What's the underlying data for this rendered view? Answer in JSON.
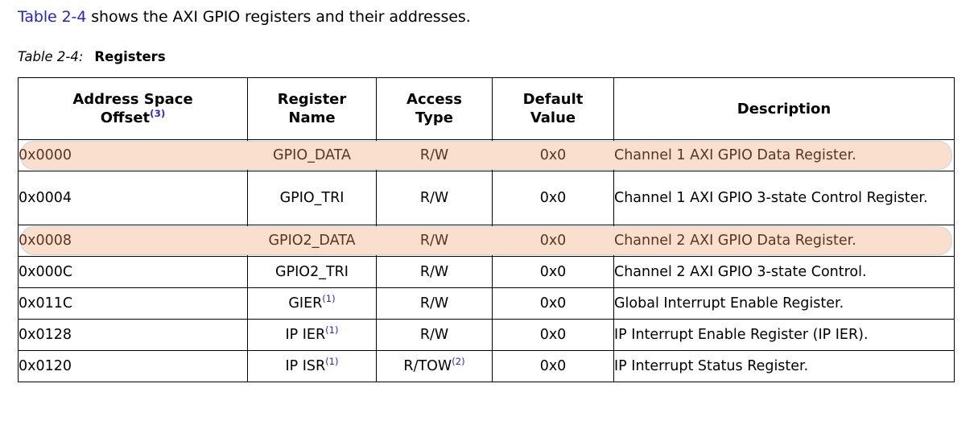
{
  "intro": {
    "link_text": "Table 2-4",
    "rest_text": " shows the AXI GPIO registers and their addresses."
  },
  "caption": {
    "number": "Table 2-4:",
    "title": "Registers"
  },
  "table": {
    "headers": [
      {
        "line1": "Address Space",
        "line2": "Offset",
        "sup": "(3)"
      },
      {
        "line1": "Register",
        "line2": "Name",
        "sup": ""
      },
      {
        "line1": "Access",
        "line2": "Type",
        "sup": ""
      },
      {
        "line1": "Default",
        "line2": "Value",
        "sup": ""
      },
      {
        "line1": "Description",
        "line2": "",
        "sup": ""
      }
    ],
    "rows": [
      {
        "offset": "0x0000",
        "name": "GPIO_DATA",
        "name_sup": "",
        "access": "R/W",
        "access_sup": "",
        "default": "0x0",
        "description": "Channel 1 AXI GPIO Data Register.",
        "highlighted": true,
        "tall": false
      },
      {
        "offset": "0x0004",
        "name": "GPIO_TRI",
        "name_sup": "",
        "access": "R/W",
        "access_sup": "",
        "default": "0x0",
        "description": "Channel 1 AXI GPIO 3-state Control Register.",
        "highlighted": false,
        "tall": true
      },
      {
        "offset": "0x0008",
        "name": "GPIO2_DATA",
        "name_sup": "",
        "access": "R/W",
        "access_sup": "",
        "default": "0x0",
        "description": "Channel 2 AXI GPIO Data Register.",
        "highlighted": true,
        "tall": false
      },
      {
        "offset": "0x000C",
        "name": "GPIO2_TRI",
        "name_sup": "",
        "access": "R/W",
        "access_sup": "",
        "default": "0x0",
        "description": "Channel 2 AXI GPIO 3-state Control.",
        "highlighted": false,
        "tall": false
      },
      {
        "offset": "0x011C",
        "name": "GIER",
        "name_sup": "(1)",
        "access": "R/W",
        "access_sup": "",
        "default": "0x0",
        "description": "Global Interrupt Enable Register.",
        "highlighted": false,
        "tall": false
      },
      {
        "offset": "0x0128",
        "name": "IP IER",
        "name_sup": "(1)",
        "access": "R/W",
        "access_sup": "",
        "default": "0x0",
        "description": "IP Interrupt Enable Register (IP IER).",
        "highlighted": false,
        "tall": false
      },
      {
        "offset": "0x0120",
        "name": "IP ISR",
        "name_sup": "(1)",
        "access": "R/TOW",
        "access_sup": "(2)",
        "default": "0x0",
        "description": "IP Interrupt Status Register.",
        "highlighted": false,
        "tall": false
      }
    ]
  },
  "colors": {
    "link": "#2626cc",
    "superscript": "#2626cc",
    "header_rule": "#651434",
    "highlight_fill": "#fadfcf",
    "highlight_border": "#c9d6d2",
    "highlight_text": "#5b3322",
    "body_text": "#000000",
    "page_background": "#ffffff"
  }
}
